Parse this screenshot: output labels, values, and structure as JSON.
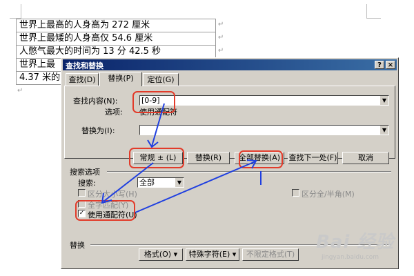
{
  "document": {
    "rows": [
      "世界上最高的人身高为 272 厘米",
      "世界上最矮的人身高仅 54.6 厘米",
      "人憋气最大的时间为 13 分 42.5 秒",
      "世界上最",
      "4.37 米的"
    ],
    "row_mark": "↵",
    "para_mark": "↵"
  },
  "dialog": {
    "title": "查找和替换",
    "help_label": "?",
    "close_label": "×",
    "tabs": [
      "查找(D)",
      "替换(P)",
      "定位(G)"
    ],
    "find_label": "查找内容(N):",
    "find_value": "[0-9]",
    "options_label": "选项:",
    "options_value": "使用通配符",
    "replace_label": "替换为(I):",
    "replace_value": "",
    "buttons": {
      "normal": "常规 ± (L)",
      "replace": "替换(R)",
      "replace_all": "全部替换(A)",
      "find_next": "查找下一处(F)",
      "cancel": "取消"
    },
    "search_options_title": "搜索选项",
    "search_label": "搜索:",
    "search_value": "全部",
    "checkboxes": {
      "match_case": "区分大小写(H)",
      "whole_word": "全字匹配(Y)",
      "use_wildcards": "使用通配符(U)",
      "full_half": "区分全/半角(M)"
    },
    "use_wildcards_checked": "✓",
    "replace_section_title": "替换",
    "bottom_buttons": {
      "format": "格式(O) ▾",
      "special": "特殊字符(E) ▾",
      "no_format": "不限定格式(T)"
    }
  },
  "watermark": {
    "brand": "Bai 经验",
    "url": "jingyan.baidu.com"
  },
  "colors": {
    "annotation_red": "#e23b2a",
    "annotation_blue": "#1f3fe0",
    "title_bar": "#0a246a",
    "dialog_face": "#d4d0c8"
  }
}
